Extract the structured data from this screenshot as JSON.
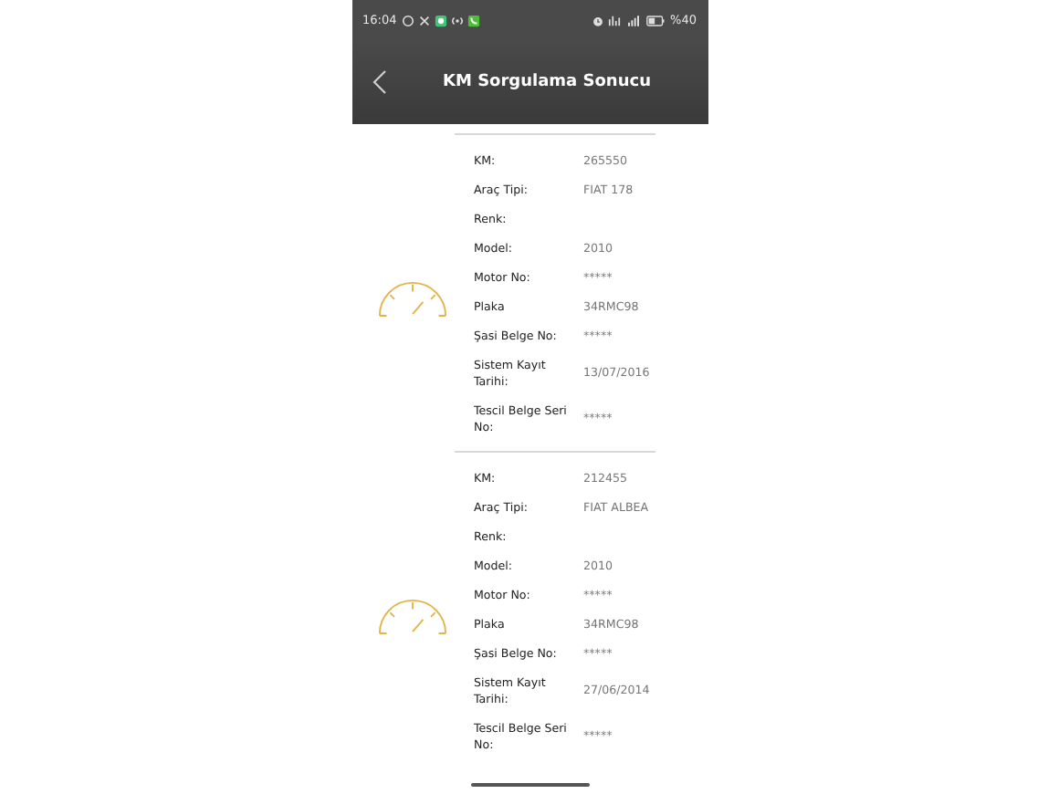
{
  "status_bar": {
    "time": "16:04",
    "battery": "%40"
  },
  "header": {
    "title": "KM Sorgulama Sonucu"
  },
  "records": [
    {
      "fields": [
        {
          "label": "KM:",
          "value": "265550"
        },
        {
          "label": "Araç Tipi:",
          "value": "FIAT 178"
        },
        {
          "label": "Renk:"
        },
        {
          "label": "Model:",
          "value": "2010"
        },
        {
          "label": "Motor No:",
          "value": "*****"
        },
        {
          "label": "Plaka",
          "value": "34RMC98"
        },
        {
          "label": "Şasi Belge No:",
          "value": "*****"
        },
        {
          "label": "Sistem Kayıt Tarihi:",
          "value": "13/07/2016"
        },
        {
          "label": "Tescil Belge Seri No:",
          "value": "*****"
        }
      ]
    },
    {
      "fields": [
        {
          "label": "KM:",
          "value": "212455"
        },
        {
          "label": "Araç Tipi:",
          "value": "FIAT ALBEA"
        },
        {
          "label": "Renk:"
        },
        {
          "label": "Model:",
          "value": "2010"
        },
        {
          "label": "Motor No:",
          "value": "*****"
        },
        {
          "label": "Plaka",
          "value": "34RMC98"
        },
        {
          "label": "Şasi Belge No:",
          "value": "*****"
        },
        {
          "label": "Sistem Kayıt Tarihi:",
          "value": "27/06/2014"
        },
        {
          "label": "Tescil Belge Seri No:",
          "value": "*****"
        }
      ]
    }
  ]
}
